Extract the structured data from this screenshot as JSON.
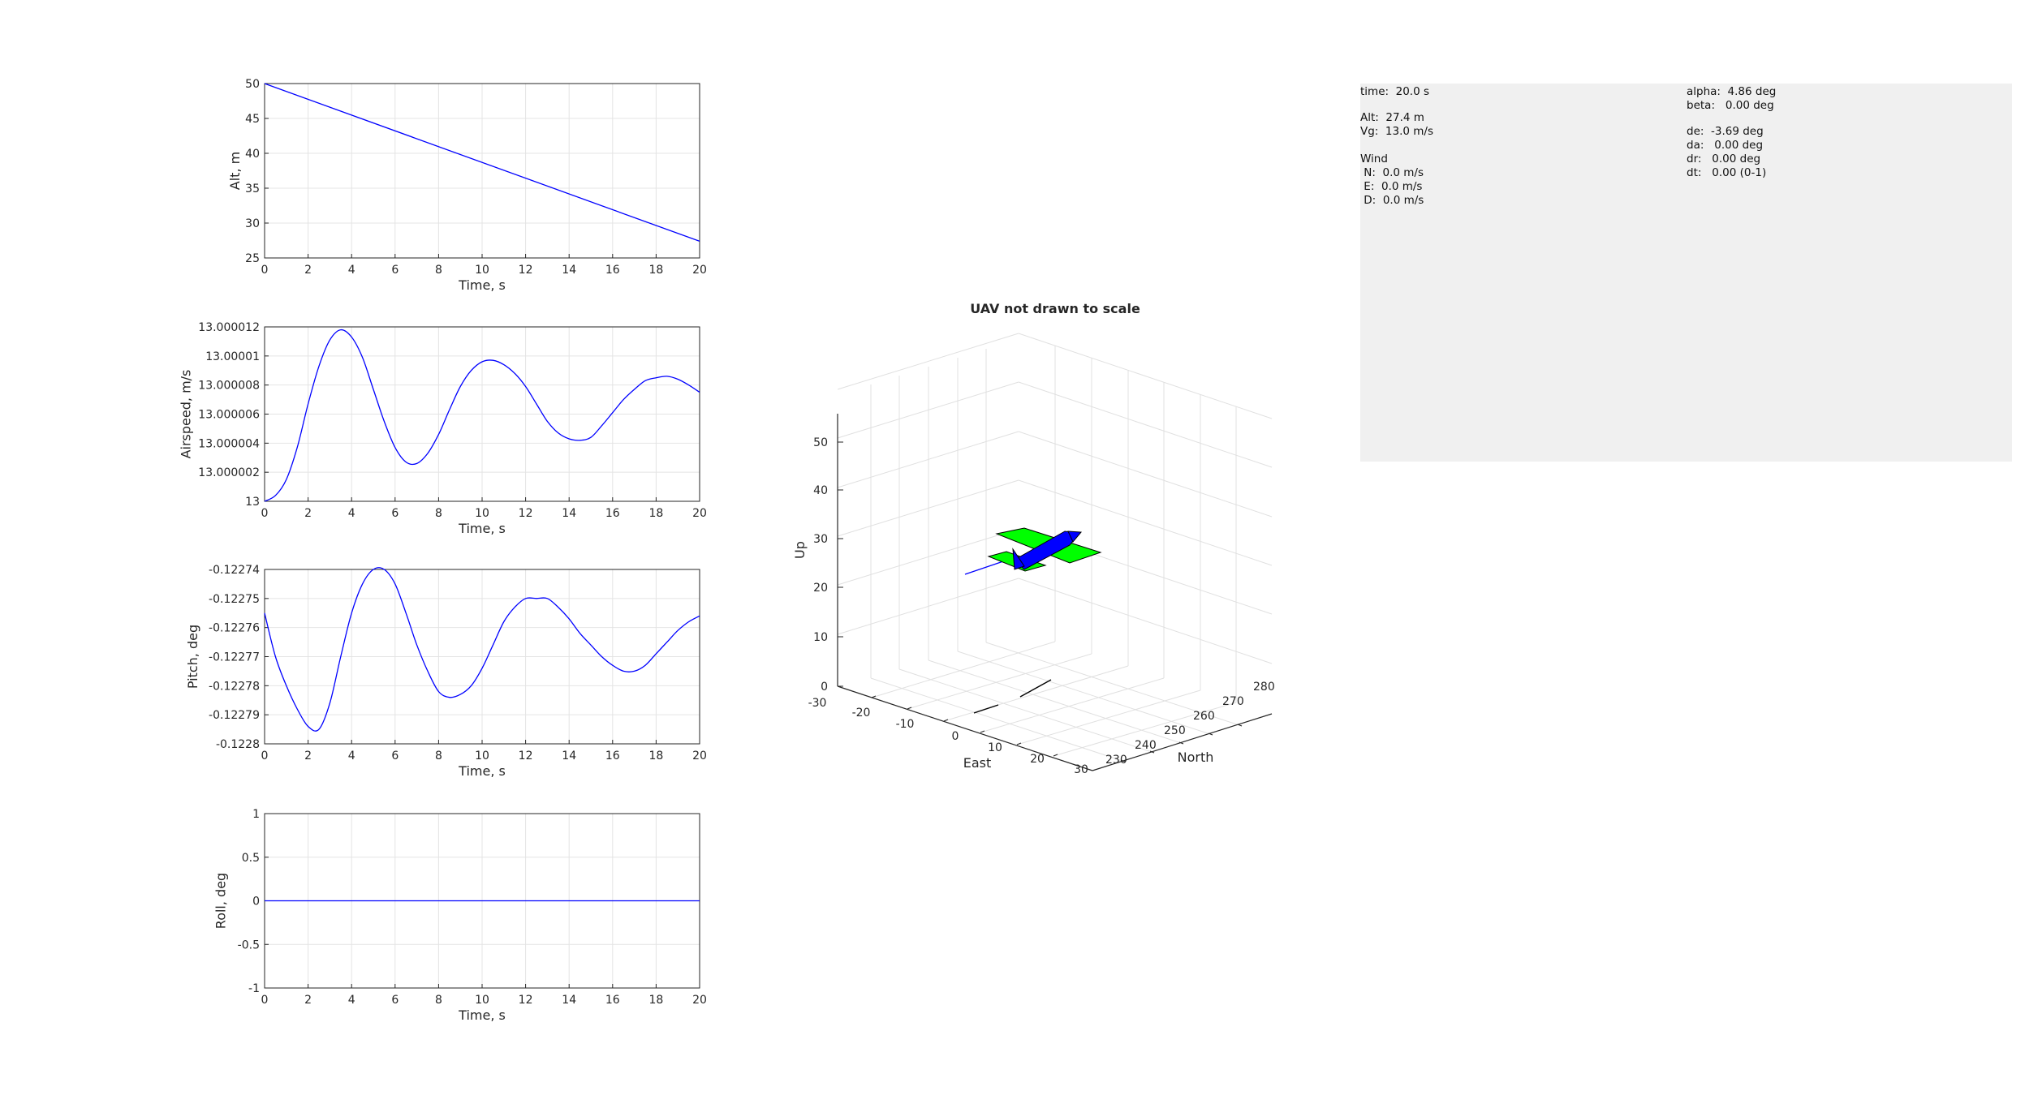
{
  "chart_data": [
    {
      "type": "line",
      "xlabel": "Time, s",
      "ylabel": "Alt, m",
      "xlim": [
        0,
        20
      ],
      "ylim": [
        25,
        50
      ],
      "xticks": [
        "0",
        "2",
        "4",
        "6",
        "8",
        "10",
        "12",
        "14",
        "16",
        "18",
        "20"
      ],
      "yticks": [
        "25",
        "30",
        "35",
        "40",
        "45",
        "50"
      ],
      "grid": true,
      "color": "#0000ff",
      "series": [
        {
          "x": [
            0,
            20
          ],
          "values": [
            50,
            27.4
          ]
        }
      ]
    },
    {
      "type": "line",
      "xlabel": "Time, s",
      "ylabel": "Airspeed, m/s",
      "xlim": [
        0,
        20
      ],
      "ylim": [
        13,
        13.000012
      ],
      "xticks": [
        "0",
        "2",
        "4",
        "6",
        "8",
        "10",
        "12",
        "14",
        "16",
        "18",
        "20"
      ],
      "yticks": [
        "13",
        "13.000002",
        "13.000004",
        "13.000006",
        "13.000008",
        "13.00001",
        "13.000012"
      ],
      "grid": true,
      "color": "#0000ff",
      "series": [
        {
          "x": [
            0,
            0.5,
            1,
            1.5,
            2,
            2.5,
            3,
            3.5,
            4,
            4.5,
            5,
            5.5,
            6,
            6.5,
            7,
            7.5,
            8,
            8.5,
            9,
            9.5,
            10,
            10.5,
            11,
            11.5,
            12,
            12.5,
            13,
            13.5,
            14,
            14.5,
            15,
            15.5,
            16,
            16.5,
            17,
            17.5,
            18,
            18.5,
            19,
            19.5,
            20
          ],
          "values": [
            13,
            13.0000004,
            13.0000015,
            13.0000037,
            13.0000067,
            13.0000093,
            13.0000111,
            13.0000118,
            13.0000113,
            13.0000099,
            13.0000077,
            13.0000055,
            13.0000037,
            13.0000027,
            13.0000026,
            13.0000033,
            13.0000046,
            13.0000063,
            13.0000079,
            13.000009,
            13.0000096,
            13.0000097,
            13.0000094,
            13.0000088,
            13.0000079,
            13.0000067,
            13.0000055,
            13.0000047,
            13.0000043,
            13.0000042,
            13.0000044,
            13.0000052,
            13.0000061,
            13.000007,
            13.0000077,
            13.0000083,
            13.0000085,
            13.0000086,
            13.0000084,
            13.000008,
            13.0000075
          ]
        }
      ]
    },
    {
      "type": "line",
      "xlabel": "Time, s",
      "ylabel": "Pitch, deg",
      "xlim": [
        0,
        20
      ],
      "ylim": [
        -0.1228,
        -0.12274
      ],
      "xticks": [
        "0",
        "2",
        "4",
        "6",
        "8",
        "10",
        "12",
        "14",
        "16",
        "18",
        "20"
      ],
      "yticks": [
        "-0.1228",
        "-0.12279",
        "-0.12278",
        "-0.12277",
        "-0.12276",
        "-0.12275",
        "-0.12274"
      ],
      "grid": true,
      "color": "#0000ff",
      "series": [
        {
          "x": [
            0,
            0.5,
            1,
            1.5,
            2,
            2.5,
            3,
            3.5,
            4,
            4.5,
            5,
            5.5,
            6,
            6.5,
            7,
            7.5,
            8,
            8.5,
            9,
            9.5,
            10,
            10.5,
            11,
            11.5,
            12,
            12.5,
            13,
            13.5,
            14,
            14.5,
            15,
            15.5,
            16,
            16.5,
            17,
            17.5,
            18,
            18.5,
            19,
            19.5,
            20
          ],
          "values": [
            -0.122755,
            -0.12277,
            -0.12278,
            -0.122788,
            -0.122794,
            -0.122795,
            -0.122786,
            -0.12277,
            -0.122755,
            -0.122745,
            -0.12274,
            -0.12274,
            -0.122745,
            -0.122755,
            -0.122766,
            -0.122775,
            -0.122782,
            -0.122784,
            -0.122783,
            -0.12278,
            -0.122774,
            -0.122766,
            -0.122758,
            -0.122753,
            -0.12275,
            -0.12275,
            -0.12275,
            -0.122753,
            -0.122757,
            -0.122762,
            -0.122766,
            -0.12277,
            -0.122773,
            -0.122775,
            -0.122775,
            -0.122773,
            -0.122769,
            -0.122765,
            -0.122761,
            -0.122758,
            -0.122756
          ]
        }
      ]
    },
    {
      "type": "line",
      "xlabel": "Time, s",
      "ylabel": "Roll, deg",
      "xlim": [
        0,
        20
      ],
      "ylim": [
        -1,
        1
      ],
      "xticks": [
        "0",
        "2",
        "4",
        "6",
        "8",
        "10",
        "12",
        "14",
        "16",
        "18",
        "20"
      ],
      "yticks": [
        "-1",
        "-0.5",
        "0",
        "0.5",
        "1"
      ],
      "grid": true,
      "color": "#0000ff",
      "series": [
        {
          "x": [
            0,
            20
          ],
          "values": [
            0,
            0
          ]
        }
      ]
    },
    {
      "type": "scatter",
      "title": "UAV not drawn to scale",
      "xlabel": "East",
      "ylabel": "North",
      "zlabel": "Up",
      "east_ticks": [
        "-30",
        "-20",
        "-10",
        "0",
        "10",
        "20",
        "30"
      ],
      "north_ticks": [
        "230",
        "240",
        "250",
        "260",
        "270",
        "280"
      ],
      "up_ticks": [
        "0",
        "10",
        "20",
        "30",
        "40",
        "50"
      ],
      "grid": true,
      "aircraft_colors": {
        "body": "#0000ff",
        "wings": "#00ff00"
      }
    }
  ],
  "panel": {
    "time": "time:  20.0 s",
    "alt": "Alt:  27.4 m",
    "vg": "Vg:  13.0 m/s",
    "wind_title": "Wind",
    "wind_n": " N:  0.0 m/s",
    "wind_e": " E:  0.0 m/s",
    "wind_d": " D:  0.0 m/s",
    "alpha": "alpha:  4.86 deg",
    "beta": "beta:   0.00 deg",
    "de": "de:  -3.69 deg",
    "da": "da:   0.00 deg",
    "dr": "dr:   0.00 deg",
    "dt": "dt:   0.00 (0-1)"
  }
}
